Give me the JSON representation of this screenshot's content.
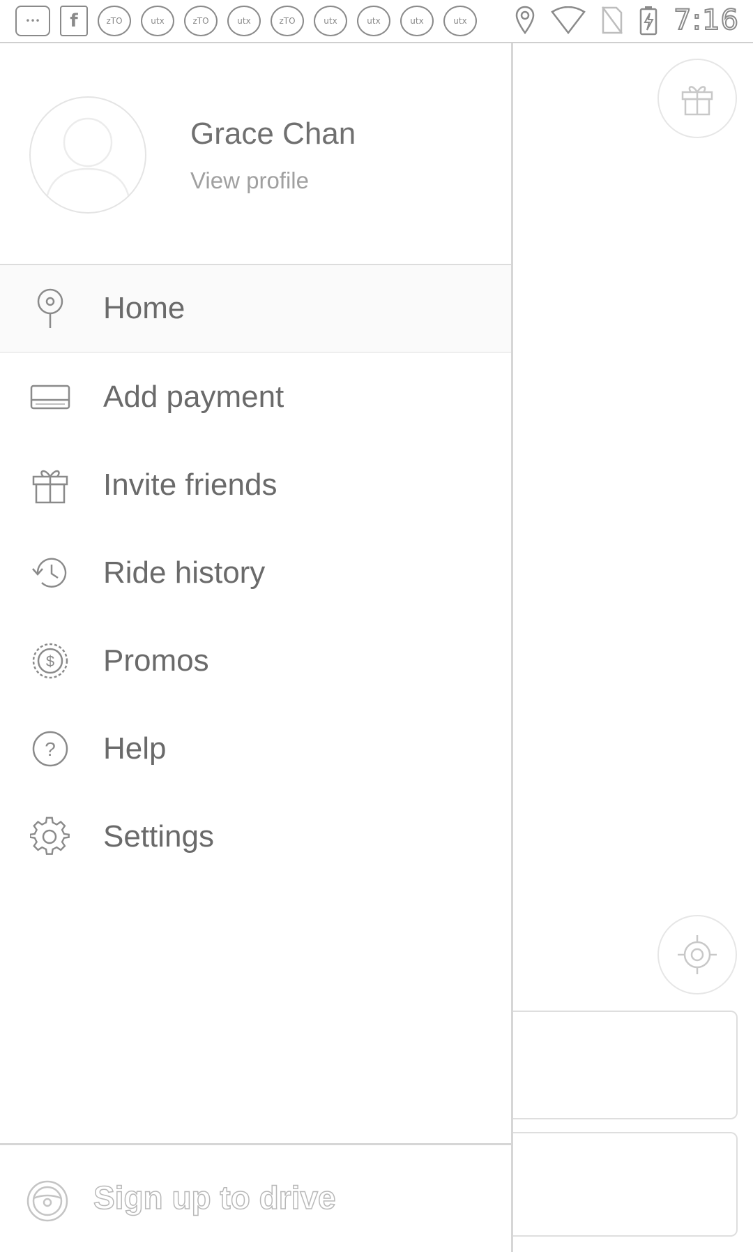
{
  "status_bar": {
    "notification_icons": [
      {
        "name": "messages-icon",
        "label": "•••"
      },
      {
        "name": "facebook-icon",
        "label": "f"
      },
      {
        "name": "app-icon",
        "label": "zTO"
      },
      {
        "name": "app-icon",
        "label": "utx"
      },
      {
        "name": "app-icon",
        "label": "zTO"
      },
      {
        "name": "app-icon",
        "label": "utx"
      },
      {
        "name": "app-icon",
        "label": "zTO"
      },
      {
        "name": "app-icon",
        "label": "utx"
      },
      {
        "name": "app-icon",
        "label": "utx"
      },
      {
        "name": "app-icon",
        "label": "utx"
      },
      {
        "name": "app-icon",
        "label": "utx"
      }
    ],
    "time": "7:16"
  },
  "drawer": {
    "user_name": "Grace Chan",
    "view_profile": "View profile",
    "menu": [
      {
        "icon": "location-pin-icon",
        "label": "Home"
      },
      {
        "icon": "credit-card-icon",
        "label": "Add payment"
      },
      {
        "icon": "gift-icon",
        "label": "Invite friends"
      },
      {
        "icon": "history-icon",
        "label": "Ride history"
      },
      {
        "icon": "promo-badge-icon",
        "label": "Promos"
      },
      {
        "icon": "help-icon",
        "label": "Help"
      },
      {
        "icon": "settings-gear-icon",
        "label": "Settings"
      }
    ],
    "footer_label": "Sign up to drive"
  },
  "colors": {
    "icon_stroke": "#8a8a8a",
    "divider": "#d6d6d6",
    "text": "#6f6f6f"
  }
}
